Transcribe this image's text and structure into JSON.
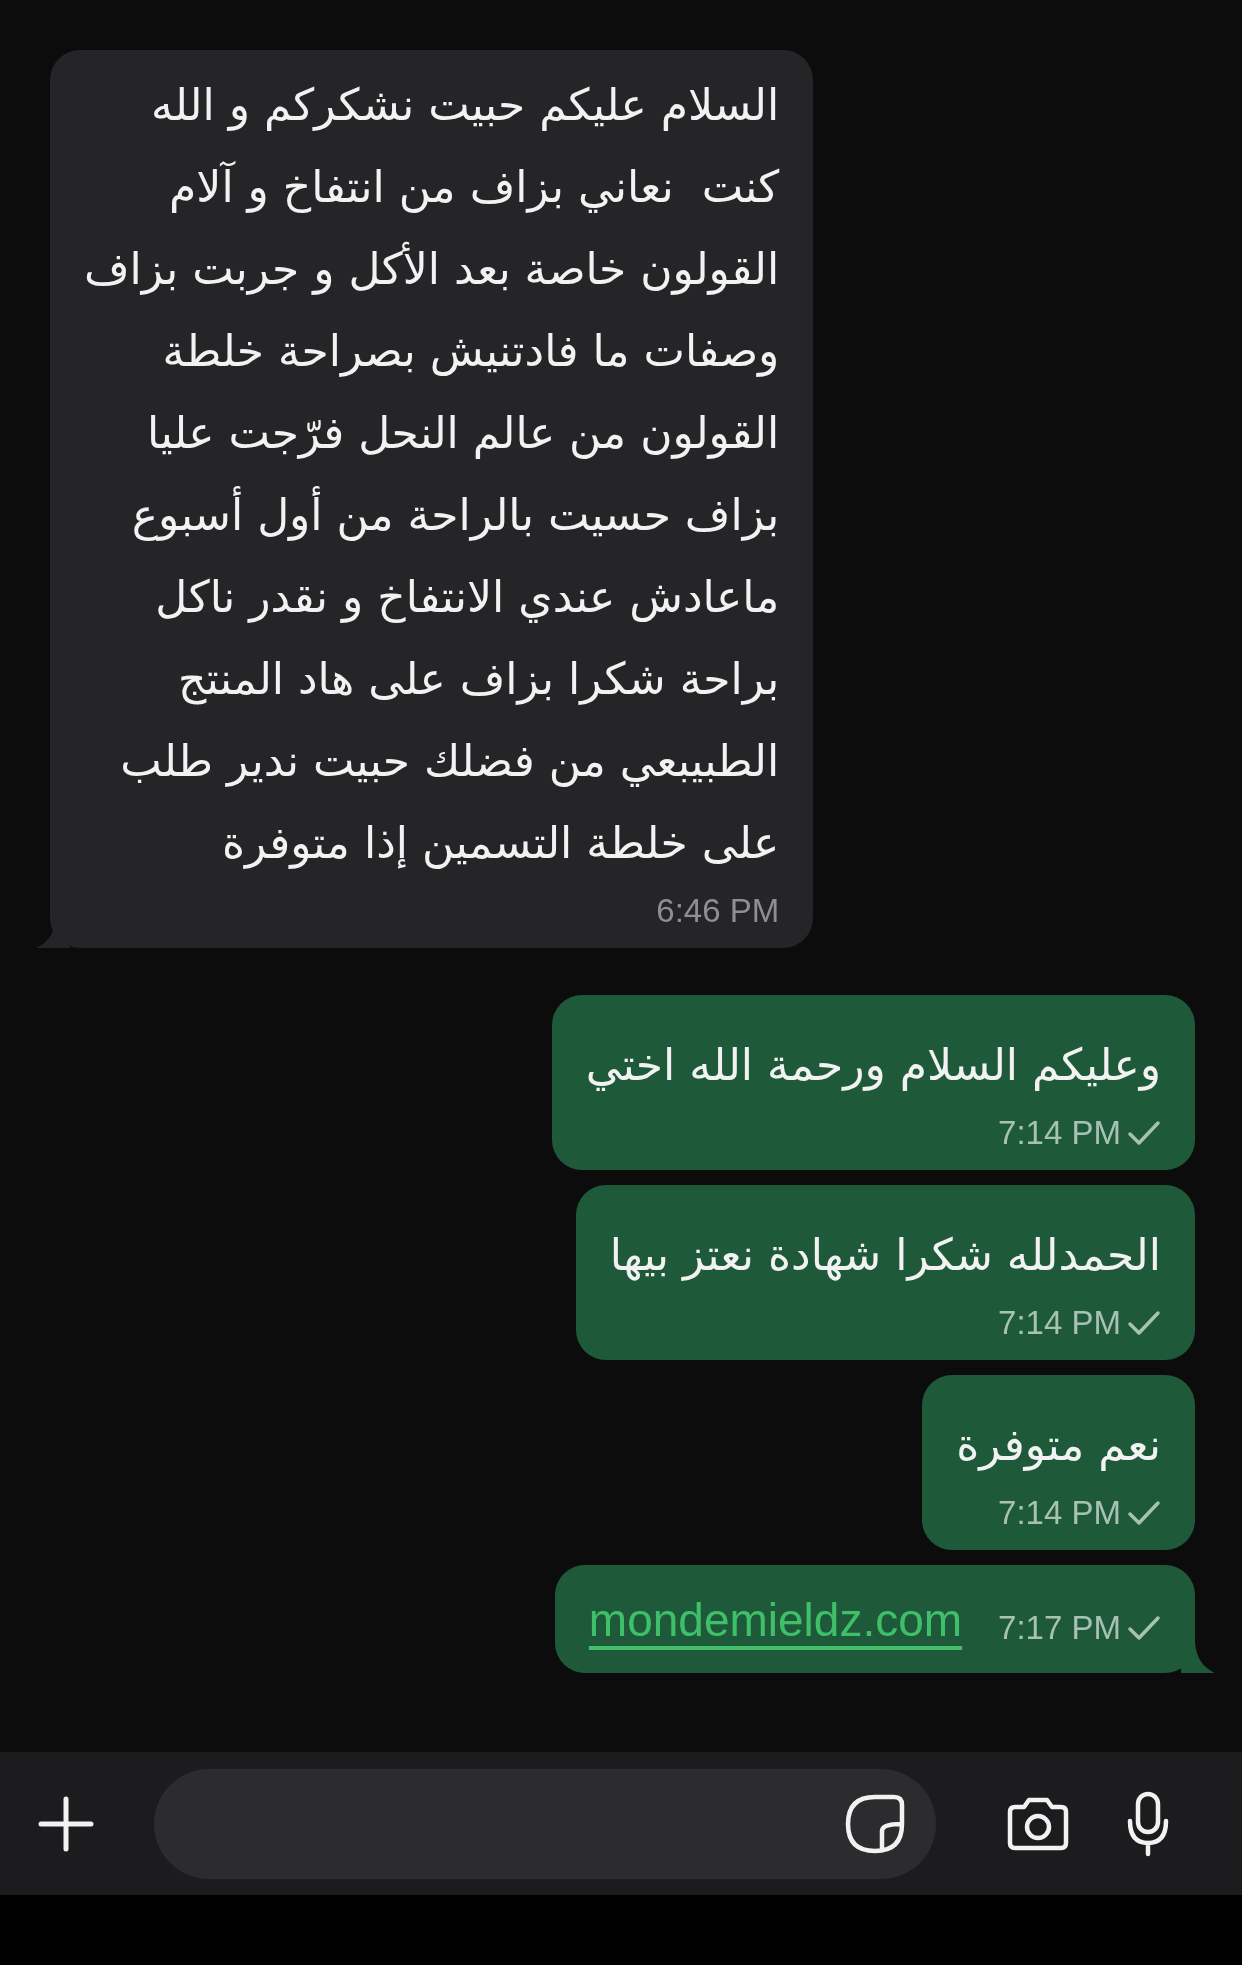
{
  "messages": [
    {
      "outgoing": false,
      "kind": "text",
      "tail": true,
      "text": "السلام عليكم حبيت نشكركم و الله\nكنت  نعاني بزاف من انتفاخ و آلام\nالقولون خاصة بعد الأكل و جربت بزاف\nوصفات ما فادتنيش بصراحة خلطة\nالقولون من عالم النحل فرّجت عليا\nبزاف حسيت بالراحة من أول أسبوع\nماعادش عندي الانتفاخ و نقدر ناكل\nبراحة شكرا بزاف على هاد المنتج\nالطبيبعي من فضلك حبيت ندير طلب\nعلى خلطة التسمين إذا متوفرة",
      "time": "6:46 PM",
      "sent": false
    },
    {
      "outgoing": true,
      "kind": "text",
      "tail": false,
      "text": "وعليكم السلام ورحمة الله اختي",
      "time": "7:14 PM",
      "sent": true
    },
    {
      "outgoing": true,
      "kind": "text",
      "tail": false,
      "text": "الحمدلله شكرا شهادة نعتز بيها",
      "time": "7:14 PM",
      "sent": true
    },
    {
      "outgoing": true,
      "kind": "text",
      "tail": false,
      "text": "نعم متوفرة",
      "time": "7:14 PM",
      "sent": true
    },
    {
      "outgoing": true,
      "kind": "link",
      "tail": true,
      "text": "mondemieldz.com",
      "time": "7:17 PM",
      "sent": true
    }
  ]
}
